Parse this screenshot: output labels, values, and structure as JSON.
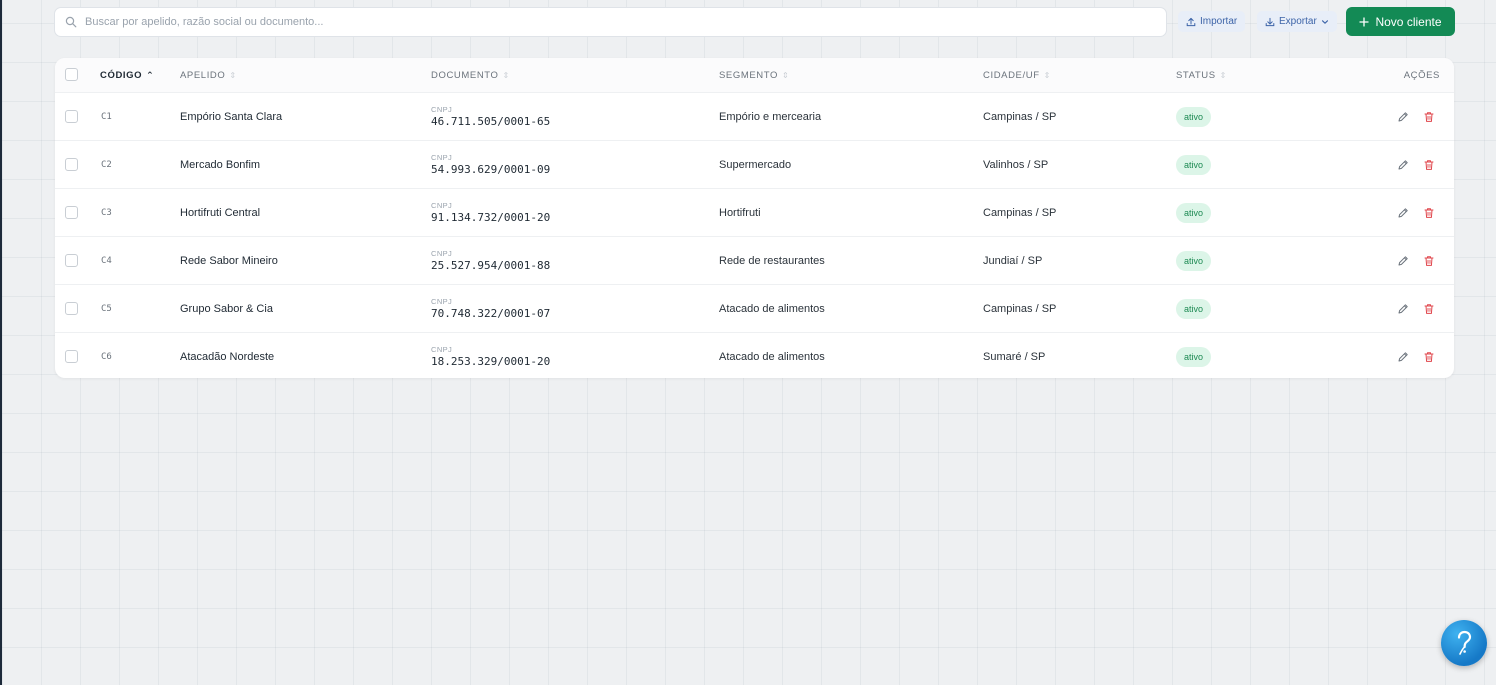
{
  "search": {
    "placeholder": "Buscar por apelido, razão social ou documento...",
    "value": ""
  },
  "toolbar": {
    "import_label": "Importar",
    "export_label": "Exportar",
    "new_label": "Novo cliente"
  },
  "table": {
    "columns": {
      "code": "CÓDIGO",
      "name": "APELIDO",
      "document": "DOCUMENTO",
      "segment": "SEGMENTO",
      "city": "CIDADE/UF",
      "status": "STATUS",
      "actions": "AÇÕES"
    },
    "rows": [
      {
        "code": "C1",
        "name": "Empório Santa Clara",
        "doc_type": "CNPJ",
        "doc": "46.711.505/0001-65",
        "segment": "Empório e mercearia",
        "city": "Campinas / SP",
        "status": "ativo"
      },
      {
        "code": "C2",
        "name": "Mercado Bonfim",
        "doc_type": "CNPJ",
        "doc": "54.993.629/0001-09",
        "segment": "Supermercado",
        "city": "Valinhos / SP",
        "status": "ativo"
      },
      {
        "code": "C3",
        "name": "Hortifruti Central",
        "doc_type": "CNPJ",
        "doc": "91.134.732/0001-20",
        "segment": "Hortifruti",
        "city": "Campinas / SP",
        "status": "ativo"
      },
      {
        "code": "C4",
        "name": "Rede Sabor Mineiro",
        "doc_type": "CNPJ",
        "doc": "25.527.954/0001-88",
        "segment": "Rede de restaurantes",
        "city": "Jundiaí / SP",
        "status": "ativo"
      },
      {
        "code": "C5",
        "name": "Grupo Sabor & Cia",
        "doc_type": "CNPJ",
        "doc": "70.748.322/0001-07",
        "segment": "Atacado de alimentos",
        "city": "Campinas / SP",
        "status": "ativo"
      },
      {
        "code": "C6",
        "name": "Atacadão Nordeste",
        "doc_type": "CNPJ",
        "doc": "18.253.329/0001-20",
        "segment": "Atacado de alimentos",
        "city": "Sumaré / SP",
        "status": "ativo"
      }
    ]
  },
  "colors": {
    "primary": "#138a55",
    "status_bg": "#dcf5e8",
    "status_text": "#1d8a53",
    "delete": "#e0454b",
    "help": "#1f8ee0"
  },
  "icons": {
    "search": "search-icon",
    "import": "upload-icon",
    "export": "download-icon",
    "export_menu": "chevron-down-icon",
    "new": "plus-icon",
    "edit": "pencil-icon",
    "delete": "trash-icon",
    "help": "help-icon",
    "sort": "sort-icon"
  }
}
